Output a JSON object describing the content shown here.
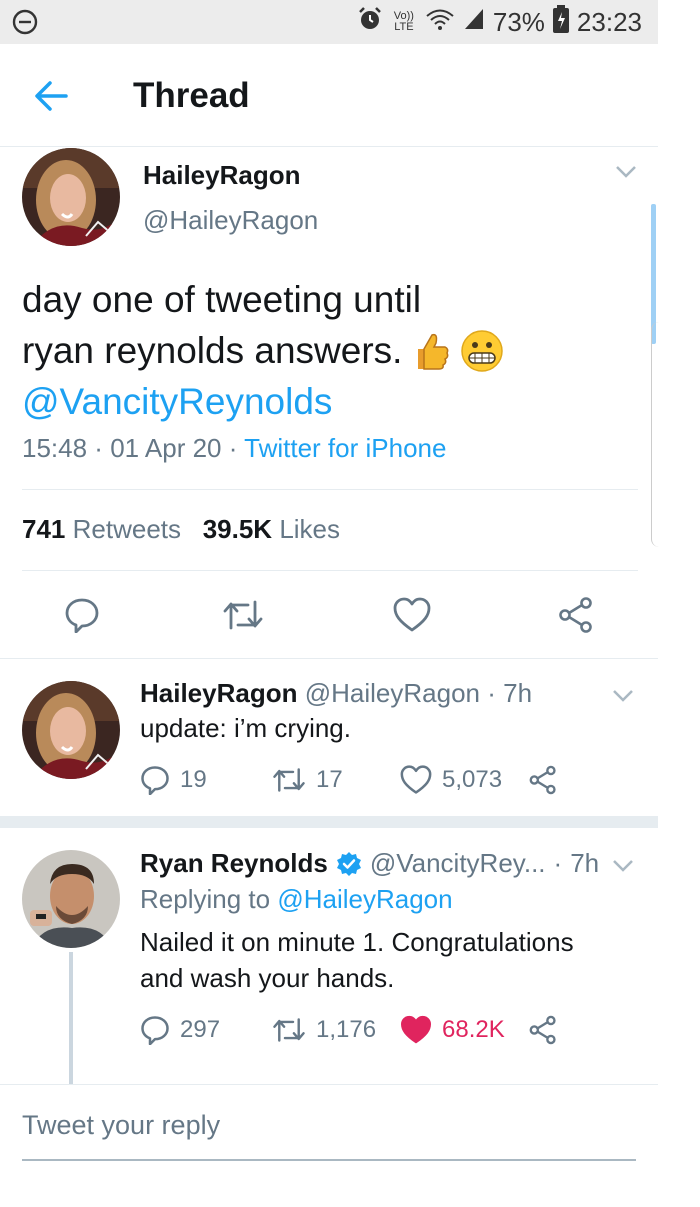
{
  "status_bar": {
    "volte": "Vo)) LTE",
    "battery": "73%",
    "time": "23:23"
  },
  "header": {
    "title": "Thread"
  },
  "main_tweet": {
    "name": "HaileyRagon",
    "handle": "@HaileyRagon",
    "text_line1": "day one of tweeting until",
    "text_line2": "ryan reynolds answers.",
    "mention": "@VancityReynolds",
    "time": "15:48",
    "date": "01 Apr 20",
    "source": "Twitter for iPhone",
    "retweets_count": "741",
    "retweets_label": "Retweets",
    "likes_count": "39.5K",
    "likes_label": "Likes"
  },
  "reply1": {
    "name": "HaileyRagon",
    "handle": "@HaileyRagon",
    "age": "7h",
    "text": "update: i’m crying.",
    "replies": "19",
    "retweets": "17",
    "likes": "5,073"
  },
  "reply2": {
    "name": "Ryan Reynolds",
    "handle": "@VancityRey...",
    "age": "7h",
    "replying_prefix": "Replying to",
    "replying_to": "@HaileyRagon",
    "text_line1": "Nailed it on minute 1. Congratulations",
    "text_line2": "and wash your hands.",
    "replies": "297",
    "retweets": "1,176",
    "likes": "68.2K"
  },
  "composer": {
    "placeholder": "Tweet your reply"
  },
  "colors": {
    "accent": "#1da1f2",
    "like": "#e0245e",
    "muted": "#657786"
  },
  "icons": [
    "dnd-icon",
    "alarm-icon",
    "wifi-icon",
    "signal-icon",
    "battery-icon",
    "back-arrow-icon",
    "chevron-down-icon",
    "reply-icon",
    "retweet-icon",
    "heart-icon",
    "share-icon",
    "verified-icon",
    "thumbs-up-emoji",
    "grimace-emoji"
  ]
}
